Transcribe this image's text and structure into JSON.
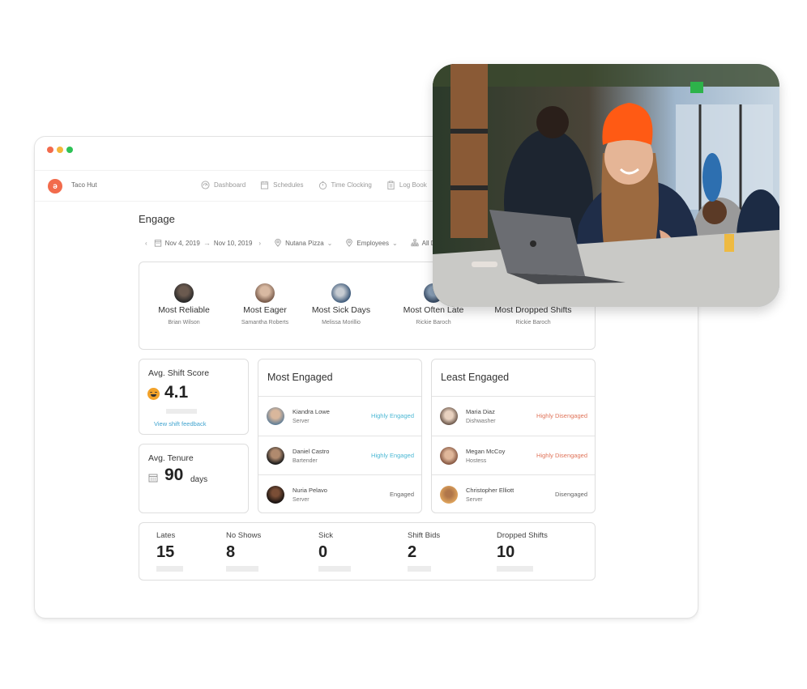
{
  "window": {
    "controls": [
      "close",
      "minimize",
      "maximize"
    ]
  },
  "navbar": {
    "brand": "Taco Hut",
    "items": [
      {
        "label": "Dashboard",
        "icon": "gauge-icon"
      },
      {
        "label": "Schedules",
        "icon": "calendar-icon"
      },
      {
        "label": "Time Clocking",
        "icon": "stopwatch-icon"
      },
      {
        "label": "Log Book",
        "icon": "clipboard-icon"
      }
    ]
  },
  "page": {
    "title": "Engage",
    "filters": {
      "start_date": "Nov 4, 2019",
      "end_date": "Nov 10, 2019",
      "location": "Nutana Pizza",
      "employees": "Employees",
      "departments": "All D"
    }
  },
  "awards": [
    {
      "title": "Most Reliable",
      "name": "Brian Wilson"
    },
    {
      "title": "Most Eager",
      "name": "Samantha Roberts"
    },
    {
      "title": "Most Sick Days",
      "name": "Melissa Morillio"
    },
    {
      "title": "Most Often Late",
      "name": "Rickie Baroch"
    },
    {
      "title": "Most Dropped Shifts",
      "name": "Rickie Baroch"
    }
  ],
  "shift_score": {
    "label": "Avg. Shift Score",
    "value": "4.1",
    "link": "View shift feedback"
  },
  "tenure": {
    "label": "Avg. Tenure",
    "value": "90",
    "unit": "days"
  },
  "most_engaged": {
    "title": "Most Engaged",
    "rows": [
      {
        "name": "Kiandra Lowe",
        "role": "Server",
        "status": "Highly Engaged"
      },
      {
        "name": "Daniel Castro",
        "role": "Bartender",
        "status": "Highly Engaged"
      },
      {
        "name": "Nuria Pelavo",
        "role": "Server",
        "status": "Engaged"
      }
    ]
  },
  "least_engaged": {
    "title": "Least Engaged",
    "rows": [
      {
        "name": "Maria Diaz",
        "role": "Dishwasher",
        "status": "Highly Disengaged"
      },
      {
        "name": "Megan McCoy",
        "role": "Hostess",
        "status": "Highly Disengaged"
      },
      {
        "name": "Christopher Elliott",
        "role": "Server",
        "status": "Disengaged"
      }
    ]
  },
  "counts": [
    {
      "label": "Lates",
      "value": "15"
    },
    {
      "label": "No Shows",
      "value": "8"
    },
    {
      "label": "Sick",
      "value": "0"
    },
    {
      "label": "Shift Bids",
      "value": "2"
    },
    {
      "label": "Dropped Shifts",
      "value": "10"
    }
  ],
  "colors": {
    "accent": "#f26b4c",
    "engaged": "#4cb8d4",
    "disengaged": "#e0745a",
    "neutral_status": "#666666",
    "link": "#3fa3cf"
  },
  "photo": {
    "description": "Smiling woman in orange beanie using laptop in restaurant"
  }
}
